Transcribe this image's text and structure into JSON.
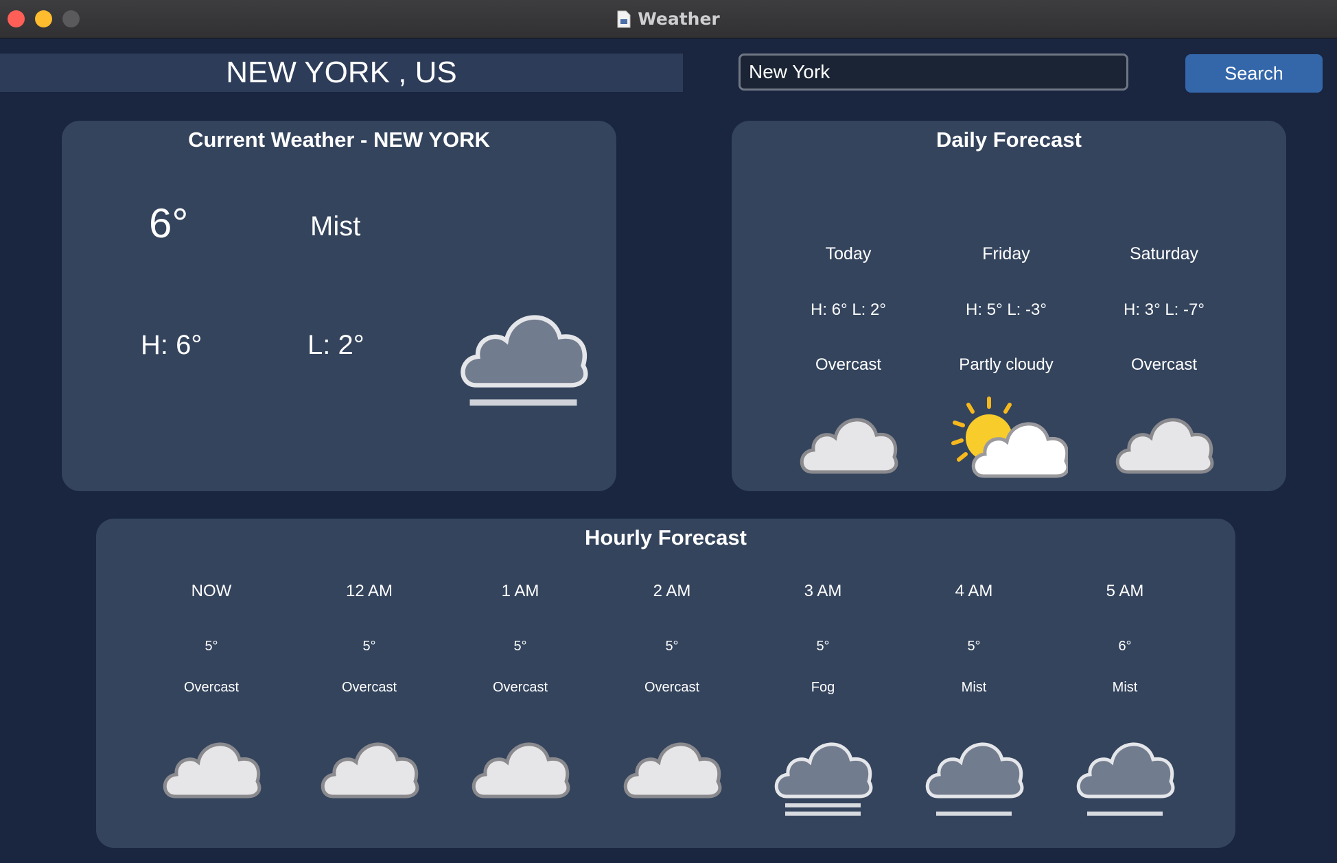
{
  "window": {
    "title": "Weather"
  },
  "header": {
    "city_banner": "NEW YORK , US",
    "search_value": "New York",
    "search_button": "Search"
  },
  "current": {
    "title": "Current Weather - NEW YORK",
    "temp": "6°",
    "description": "Mist",
    "high": "H: 6°",
    "low": "L: 2°",
    "icon": "mist-icon"
  },
  "daily": {
    "title": "Daily Forecast",
    "days": [
      {
        "day": "Today",
        "hl": "H: 6° L: 2°",
        "condition": "Overcast",
        "icon": "overcast-icon"
      },
      {
        "day": "Friday",
        "hl": "H: 5° L: -3°",
        "condition": "Partly cloudy",
        "icon": "partly-cloudy-icon"
      },
      {
        "day": "Saturday",
        "hl": "H: 3° L: -7°",
        "condition": "Overcast",
        "icon": "overcast-icon"
      }
    ]
  },
  "hourly": {
    "title": "Hourly Forecast",
    "hours": [
      {
        "time": "NOW",
        "temp": "5°",
        "condition": "Overcast",
        "icon": "overcast-icon"
      },
      {
        "time": "12 AM",
        "temp": "5°",
        "condition": "Overcast",
        "icon": "overcast-icon"
      },
      {
        "time": "1 AM",
        "temp": "5°",
        "condition": "Overcast",
        "icon": "overcast-icon"
      },
      {
        "time": "2 AM",
        "temp": "5°",
        "condition": "Overcast",
        "icon": "overcast-icon"
      },
      {
        "time": "3 AM",
        "temp": "5°",
        "condition": "Fog",
        "icon": "fog-icon"
      },
      {
        "time": "4 AM",
        "temp": "5°",
        "condition": "Mist",
        "icon": "mist-icon"
      },
      {
        "time": "5 AM",
        "temp": "6°",
        "condition": "Mist",
        "icon": "mist-icon"
      }
    ]
  }
}
